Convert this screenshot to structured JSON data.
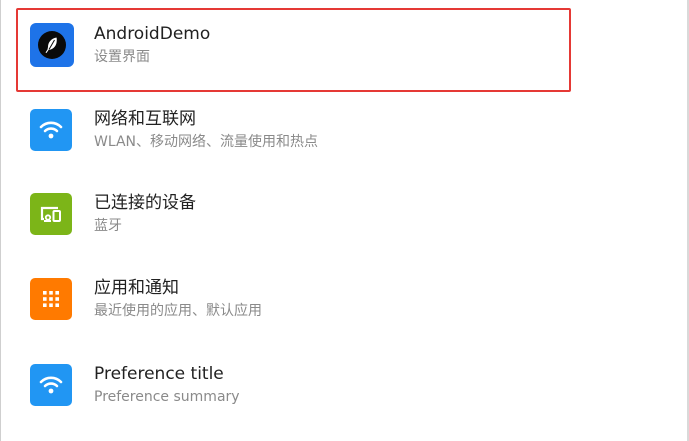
{
  "colors": {
    "highlight_border": "#e53935",
    "app_icon_bg": "#1e73e8",
    "network_icon_bg": "#2196f3",
    "devices_icon_bg": "#7cb518",
    "apps_icon_bg": "#ff7a00",
    "preference_icon_bg": "#2196f3"
  },
  "settings": {
    "items": [
      {
        "icon": "feather-icon",
        "title": "AndroidDemo",
        "summary": "设置界面"
      },
      {
        "icon": "wifi-icon",
        "title": "网络和互联网",
        "summary": "WLAN、移动网络、流量使用和热点"
      },
      {
        "icon": "connected-devices-icon",
        "title": "已连接的设备",
        "summary": "蓝牙"
      },
      {
        "icon": "apps-grid-icon",
        "title": "应用和通知",
        "summary": "最近使用的应用、默认应用"
      },
      {
        "icon": "wifi-icon",
        "title": "Preference title",
        "summary": "Preference summary"
      }
    ]
  }
}
